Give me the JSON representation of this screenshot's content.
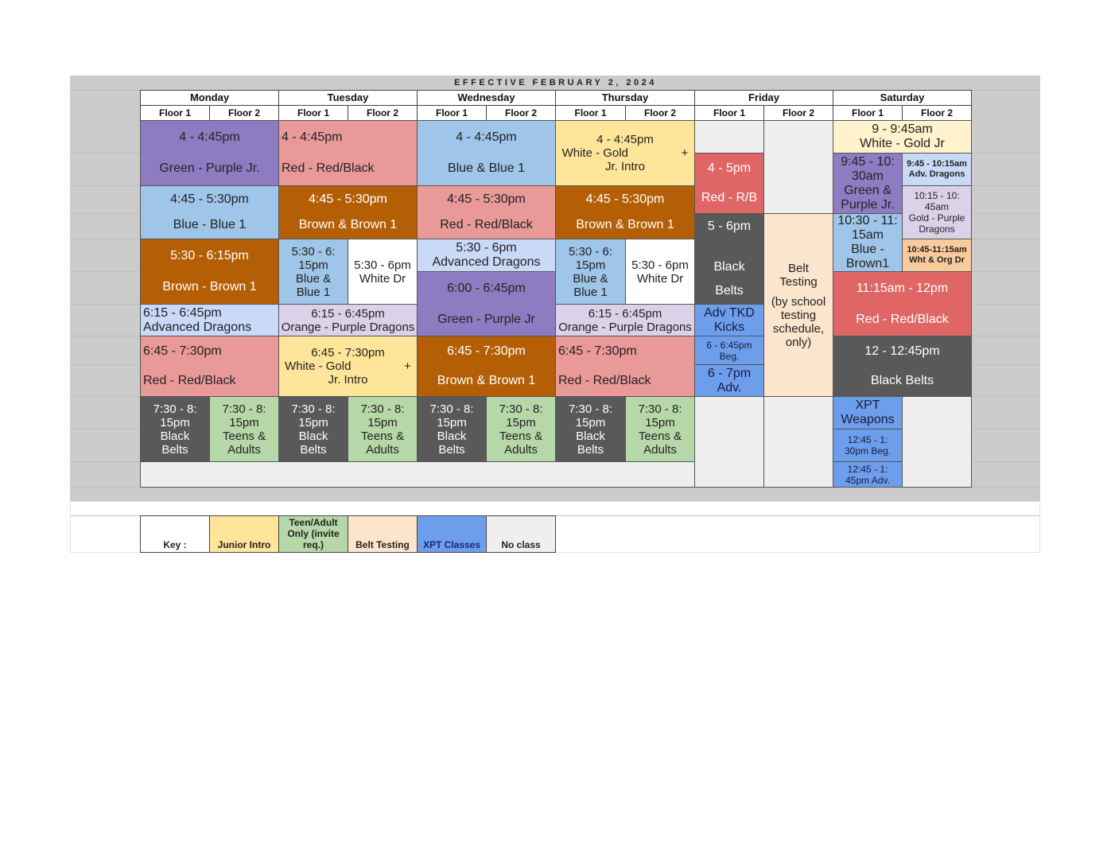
{
  "title": "EFFECTIVE FEBRUARY 2, 2024",
  "days": [
    "Monday",
    "Tuesday",
    "Wednesday",
    "Thursday",
    "Friday",
    "Saturday"
  ],
  "floors": [
    "Floor 1",
    "Floor 2"
  ],
  "colors": {
    "purple": "#8e7cc3",
    "blue": "#9fc5e8",
    "brown": "#b45f06",
    "light_blue": "#c9daf8",
    "pink": "#ea9999",
    "lavender": "#d9d2e9",
    "yellow": "#ffe599",
    "light_yellow": "#fff2cc",
    "dark_gray": "#595959",
    "green": "#b6d7a8",
    "red": "#e06666",
    "xpt_blue": "#6d9eeb",
    "peach": "#fce5cd",
    "orange": "#f9cb9c",
    "no_class": "#efefef",
    "white": "#ffffff"
  },
  "blocks": [
    {
      "day": "Monday",
      "lines": [
        "4 - 4:45pm",
        "Green - Purple Jr."
      ],
      "color": "#8e7cc3",
      "text": "#222"
    },
    {
      "day": "Monday",
      "lines": [
        "4:45 - 5:30pm",
        "Blue - Blue 1"
      ],
      "color": "#9fc5e8",
      "text": "#222"
    },
    {
      "day": "Monday",
      "lines": [
        "5:30 - 6:15pm",
        "Brown - Brown 1"
      ],
      "color": "#b45f06",
      "text": "#fff"
    },
    {
      "day": "Monday",
      "lines": [
        "6:15 - 6:45pm",
        "Advanced Dragons"
      ],
      "color": "#c9daf8",
      "text": "#222"
    },
    {
      "day": "Monday",
      "lines": [
        "6:45 - 7:30pm",
        "Red - Red/Black"
      ],
      "color": "#ea9999",
      "text": "#222"
    },
    {
      "day": "Monday",
      "lines": [
        "7:30 - 8:",
        "15pm",
        "Black",
        "Belts"
      ],
      "color": "#595959",
      "text": "#fff"
    },
    {
      "day": "Monday",
      "lines": [
        "7:30 - 8:",
        "15pm",
        "Teens &",
        "Adults"
      ],
      "color": "#b6d7a8",
      "text": "#222"
    },
    {
      "day": "Tuesday",
      "lines": [
        "4 - 4:45pm",
        "Red - Red/Black"
      ],
      "color": "#ea9999",
      "text": "#222"
    },
    {
      "day": "Tuesday",
      "lines": [
        "4:45 - 5:30pm",
        "Brown & Brown 1"
      ],
      "color": "#b45f06",
      "text": "#fff"
    },
    {
      "day": "Tuesday",
      "lines": [
        "5:30 - 6:",
        "15pm",
        "Blue &",
        "Blue 1"
      ],
      "color": "#9fc5e8",
      "text": "#222"
    },
    {
      "day": "Tuesday",
      "lines": [
        "5:30 - 6pm",
        "White Dr"
      ],
      "color": "#ffffff",
      "text": "#222"
    },
    {
      "day": "Tuesday",
      "lines": [
        "6:15 - 6:45pm",
        "Orange - Purple Dragons"
      ],
      "color": "#d9d2e9",
      "text": "#222"
    },
    {
      "day": "Tuesday",
      "lines": [
        "6:45 - 7:30pm",
        "White - Gold                +",
        "Jr. Intro"
      ],
      "color": "#ffe599",
      "text": "#222"
    },
    {
      "day": "Tuesday",
      "lines": [
        "7:30 - 8:",
        "15pm",
        "Black",
        "Belts"
      ],
      "color": "#595959",
      "text": "#fff"
    },
    {
      "day": "Tuesday",
      "lines": [
        "7:30 - 8:",
        "15pm",
        "Teens &",
        "Adults"
      ],
      "color": "#b6d7a8",
      "text": "#222"
    },
    {
      "day": "Wednesday",
      "lines": [
        "4 - 4:45pm",
        "Blue & Blue 1"
      ],
      "color": "#9fc5e8",
      "text": "#222"
    },
    {
      "day": "Wednesday",
      "lines": [
        "4:45 - 5:30pm",
        "Red - Red/Black"
      ],
      "color": "#ea9999",
      "text": "#222"
    },
    {
      "day": "Wednesday",
      "lines": [
        "5:30 - 6pm",
        "Advanced Dragons"
      ],
      "color": "#c9daf8",
      "text": "#222"
    },
    {
      "day": "Wednesday",
      "lines": [
        "6:00 - 6:45pm",
        "Green - Purple Jr"
      ],
      "color": "#8e7cc3",
      "text": "#222"
    },
    {
      "day": "Wednesday",
      "lines": [
        "6:45 - 7:30pm",
        "Brown & Brown 1"
      ],
      "color": "#b45f06",
      "text": "#fff"
    },
    {
      "day": "Wednesday",
      "lines": [
        "7:30 - 8:",
        "15pm",
        "Black",
        "Belts"
      ],
      "color": "#595959",
      "text": "#fff"
    },
    {
      "day": "Wednesday",
      "lines": [
        "7:30 - 8:",
        "15pm",
        "Teens &",
        "Adults"
      ],
      "color": "#b6d7a8",
      "text": "#222"
    },
    {
      "day": "Thursday",
      "lines": [
        "4 - 4:45pm",
        "White - Gold                +",
        "Jr. Intro"
      ],
      "color": "#ffe599",
      "text": "#222"
    },
    {
      "day": "Thursday",
      "lines": [
        "4:45 - 5:30pm",
        "Brown & Brown 1"
      ],
      "color": "#b45f06",
      "text": "#fff"
    },
    {
      "day": "Thursday",
      "lines": [
        "5:30 - 6:",
        "15pm",
        "Blue &",
        "Blue 1"
      ],
      "color": "#9fc5e8",
      "text": "#222"
    },
    {
      "day": "Thursday",
      "lines": [
        "5:30 - 6pm",
        "White Dr"
      ],
      "color": "#ffffff",
      "text": "#222"
    },
    {
      "day": "Thursday",
      "lines": [
        "6:15 - 6:45pm",
        "Orange - Purple Dragons"
      ],
      "color": "#d9d2e9",
      "text": "#222"
    },
    {
      "day": "Thursday",
      "lines": [
        "6:45 - 7:30pm",
        "Red - Red/Black"
      ],
      "color": "#ea9999",
      "text": "#222"
    },
    {
      "day": "Thursday",
      "lines": [
        "7:30 - 8:",
        "15pm",
        "Black",
        "Belts"
      ],
      "color": "#595959",
      "text": "#fff"
    },
    {
      "day": "Thursday",
      "lines": [
        "7:30 - 8:",
        "15pm",
        "Teens &",
        "Adults"
      ],
      "color": "#b6d7a8",
      "text": "#222"
    },
    {
      "day": "",
      "lines": [],
      "color": "#efefef",
      "text": "#222"
    },
    {
      "day": "Friday",
      "lines": [],
      "color": "#efefef",
      "text": "#222"
    },
    {
      "day": "Friday",
      "lines": [
        "4 - 5pm",
        "Red - R/B"
      ],
      "color": "#e06666",
      "text": "#fff"
    },
    {
      "day": "Friday",
      "lines": [
        "5 - 6pm",
        "",
        "Black",
        "Belts"
      ],
      "color": "#595959",
      "text": "#fff"
    },
    {
      "day": "Friday",
      "lines": [
        "Adv TKD",
        "Kicks"
      ],
      "color": "#6d9eeb",
      "text": "#1a1a40"
    },
    {
      "day": "Friday",
      "lines": [
        "6 - 6:45pm",
        "Beg."
      ],
      "color": "#6d9eeb",
      "text": "#1a1a40"
    },
    {
      "day": "Friday",
      "lines": [
        "6 - 7pm",
        "Adv."
      ],
      "color": "#6d9eeb",
      "text": "#1a1a40"
    },
    {
      "day": "Friday",
      "lines": [],
      "color": "#efefef",
      "text": "#222"
    },
    {
      "day": "Friday",
      "lines": [],
      "color": "#efefef",
      "text": "#222"
    },
    {
      "day": "Friday",
      "lines": [
        "Belt",
        "Testing",
        "",
        "(by school",
        "testing",
        "schedule,",
        "only)"
      ],
      "color": "#fce5cd",
      "text": "#222"
    },
    {
      "day": "Friday",
      "lines": [],
      "color": "#efefef",
      "text": "#222"
    },
    {
      "day": "Saturday",
      "lines": [
        "9 - 9:45am",
        "White - Gold Jr"
      ],
      "color": "#fff2cc",
      "text": "#222"
    },
    {
      "day": "Saturday",
      "lines": [
        "9:45 - 10:",
        "30am",
        "Green &",
        "Purple Jr."
      ],
      "color": "#8e7cc3",
      "text": "#222"
    },
    {
      "day": "Saturday",
      "lines": [
        "9:45 - 10:15am",
        "Adv. Dragons"
      ],
      "color": "#c9daf8",
      "text": "#222"
    },
    {
      "day": "Saturday",
      "lines": [
        "10:15 - 10:",
        "45am",
        "Gold - Purple",
        "Dragons"
      ],
      "color": "#d9d2e9",
      "text": "#222"
    },
    {
      "day": "Saturday",
      "lines": [
        "10:30 - 11:",
        "15am",
        "Blue -",
        "Brown1"
      ],
      "color": "#9fc5e8",
      "text": "#222"
    },
    {
      "day": "Saturday",
      "lines": [
        "10:45-11:15am",
        "Wht & Org Dr"
      ],
      "color": "#f9cb9c",
      "text": "#222"
    },
    {
      "day": "Saturday",
      "lines": [
        "11:15am - 12pm",
        "Red - Red/Black"
      ],
      "color": "#e06666",
      "text": "#fff"
    },
    {
      "day": "Saturday",
      "lines": [
        "12 - 12:45pm",
        "Black Belts"
      ],
      "color": "#595959",
      "text": "#fff"
    },
    {
      "day": "Saturday",
      "lines": [
        "XPT",
        "Weapons"
      ],
      "color": "#6d9eeb",
      "text": "#1a1a40"
    },
    {
      "day": "Saturday",
      "lines": [
        "12:45 - 1:",
        "30pm Beg."
      ],
      "color": "#6d9eeb",
      "text": "#1a1a40"
    },
    {
      "day": "Saturday",
      "lines": [
        "12:45 - 1:",
        "45pm Adv."
      ],
      "color": "#6d9eeb",
      "text": "#1a1a40"
    },
    {
      "day": "Saturday",
      "lines": [],
      "color": "#efefef",
      "text": "#222"
    }
  ],
  "key": {
    "label": "Key :",
    "items": [
      {
        "label": "Junior Intro",
        "color": "#ffe599",
        "text": "#222"
      },
      {
        "label": "Teen/Adult Only (invite req.)",
        "color": "#b6d7a8",
        "text": "#222"
      },
      {
        "label": "Belt Testing",
        "color": "#fce5cd",
        "text": "#222"
      },
      {
        "label": "XPT Classes",
        "color": "#6d9eeb",
        "text": "#1a237e"
      },
      {
        "label": "No class",
        "color": "#efefef",
        "text": "#222"
      }
    ]
  }
}
